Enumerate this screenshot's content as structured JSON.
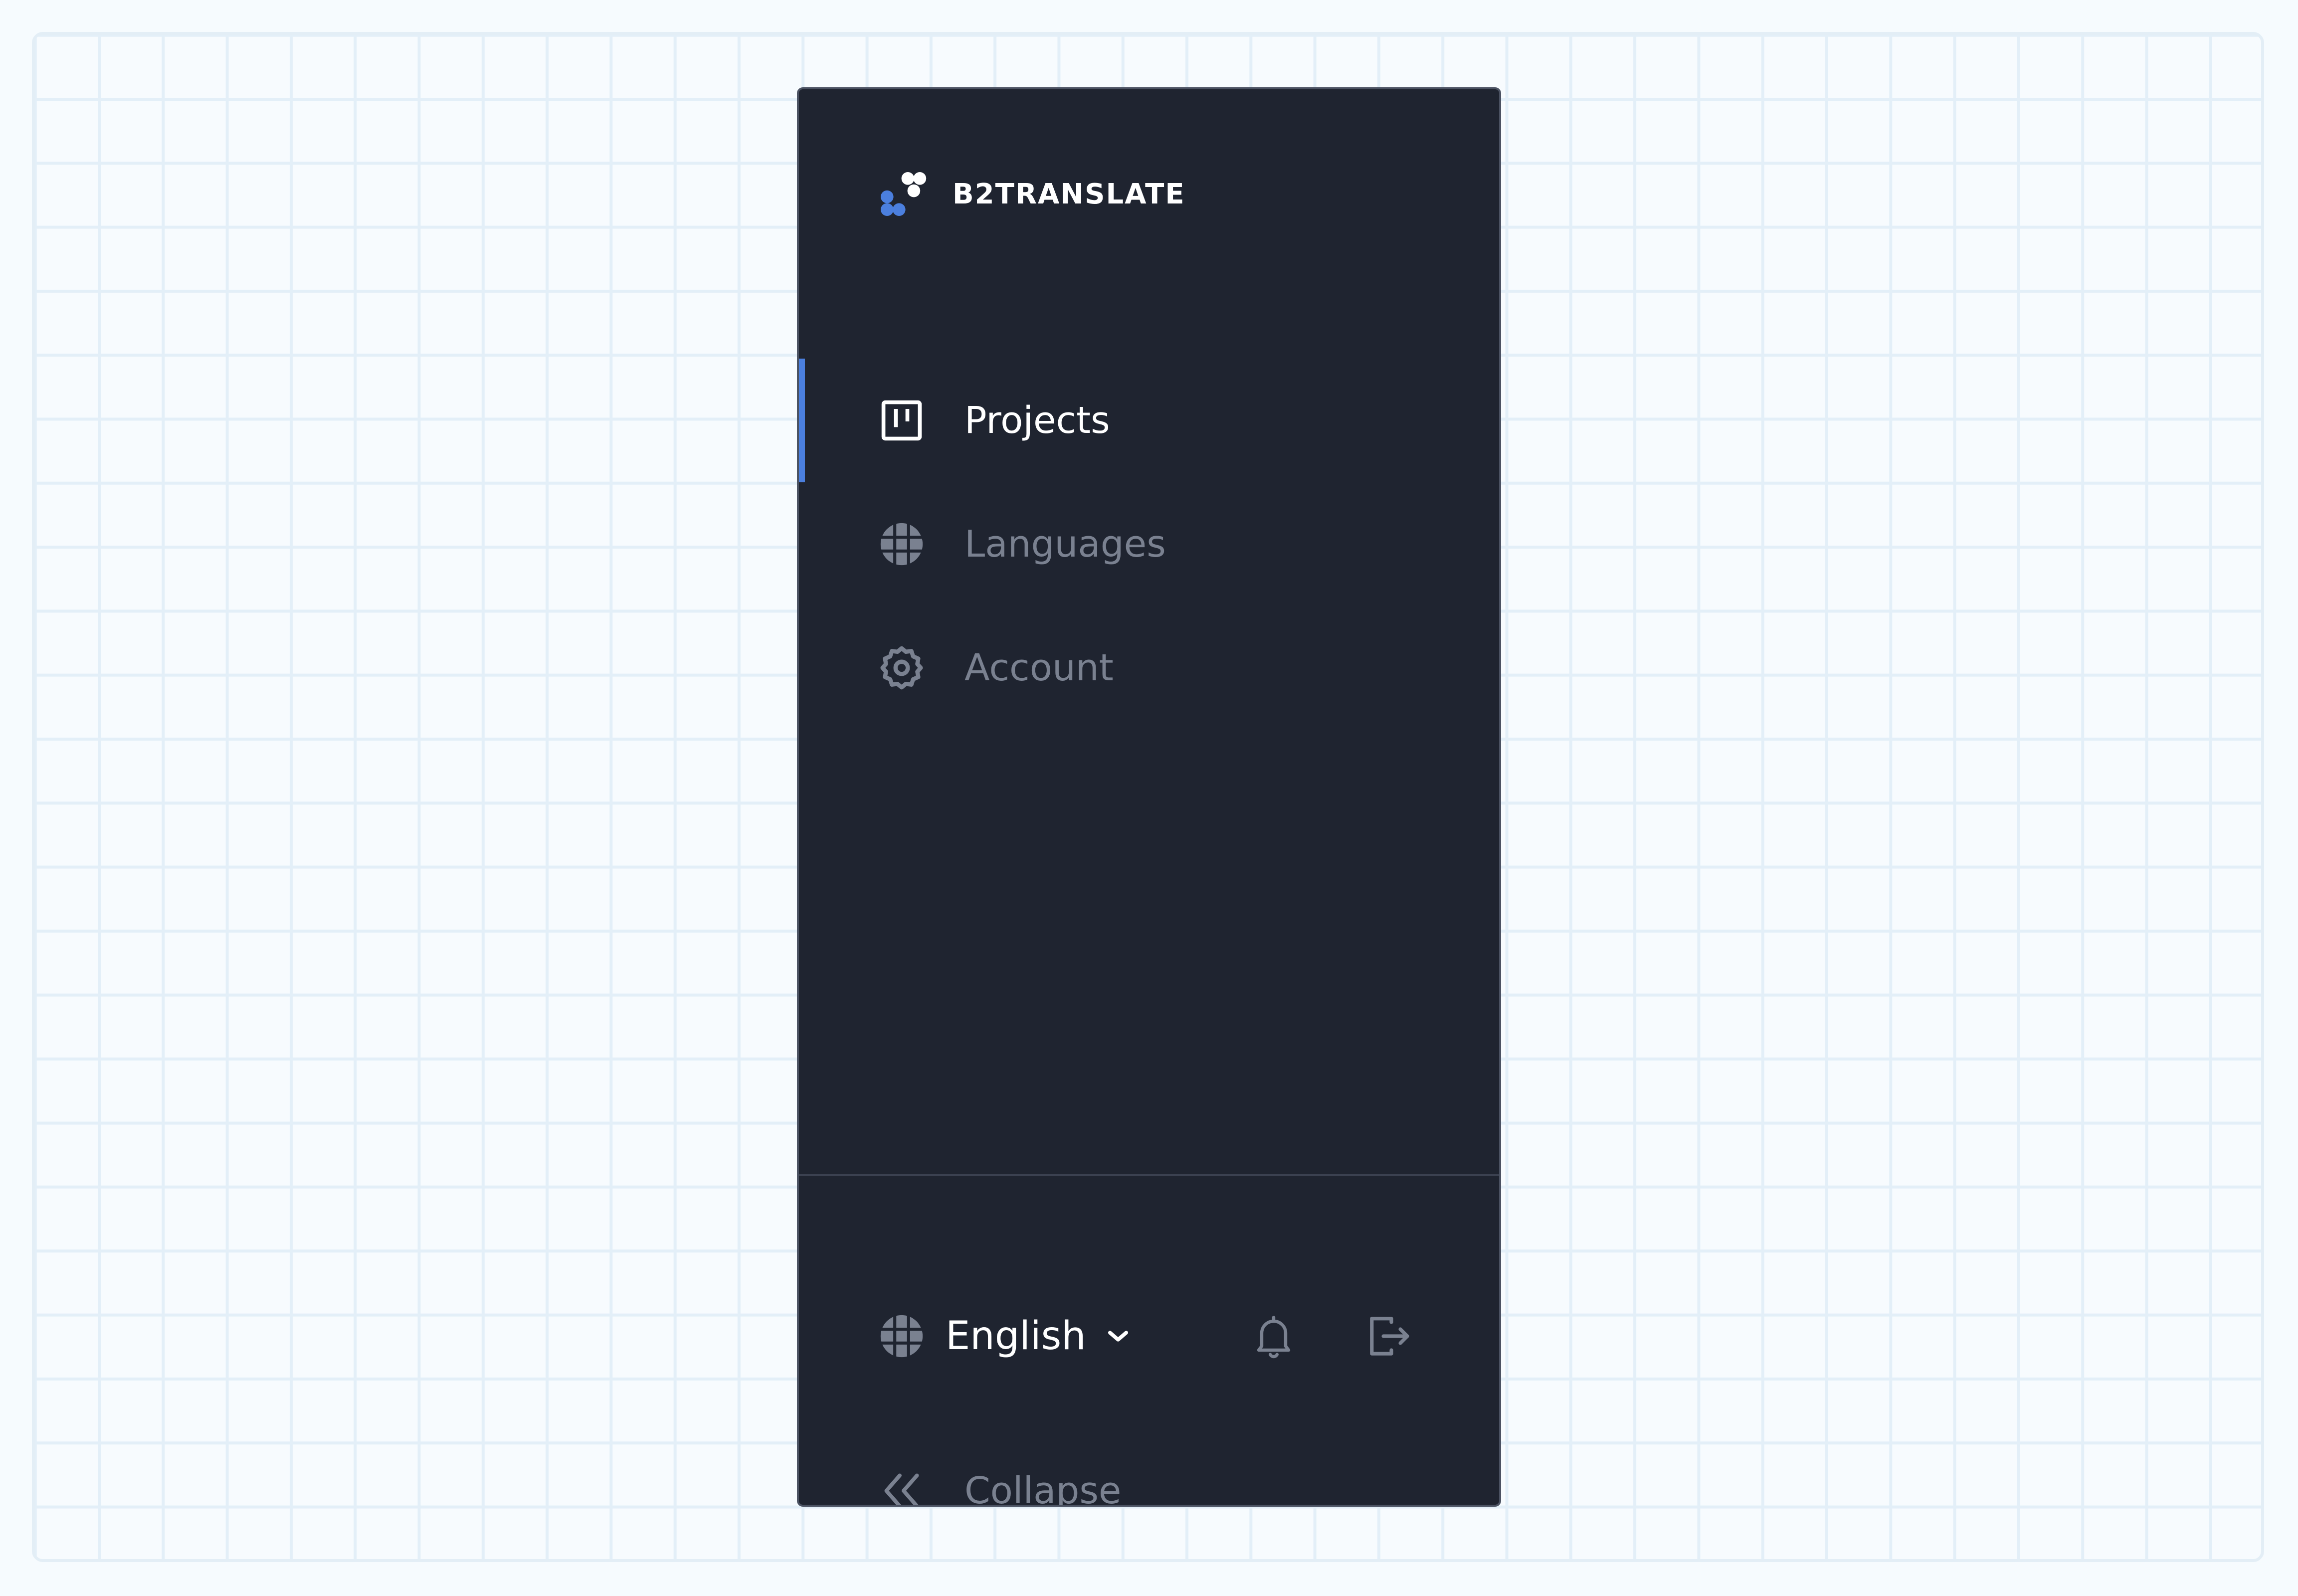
{
  "brand": {
    "name": "B2TRANSLATE",
    "colors": {
      "accent": "#4b7fde",
      "logo_light": "#ffffff"
    }
  },
  "nav": {
    "items": [
      {
        "label": "Projects",
        "icon": "kanban-board-icon",
        "active": true
      },
      {
        "label": "Languages",
        "icon": "globe-icon",
        "active": false
      },
      {
        "label": "Account",
        "icon": "gear-icon",
        "active": false
      }
    ]
  },
  "footer": {
    "language": {
      "selected": "English",
      "icon": "globe-icon",
      "dropdown_icon": "chevron-down-icon"
    },
    "notifications_icon": "bell-icon",
    "logout_icon": "logout-icon",
    "collapse": {
      "label": "Collapse",
      "icon": "double-chevron-left-icon"
    }
  },
  "theme": {
    "sidebar_bg": "#1f2430",
    "text_active": "#ffffff",
    "text_muted": "#7a8190",
    "active_indicator": "#4b7fde"
  }
}
